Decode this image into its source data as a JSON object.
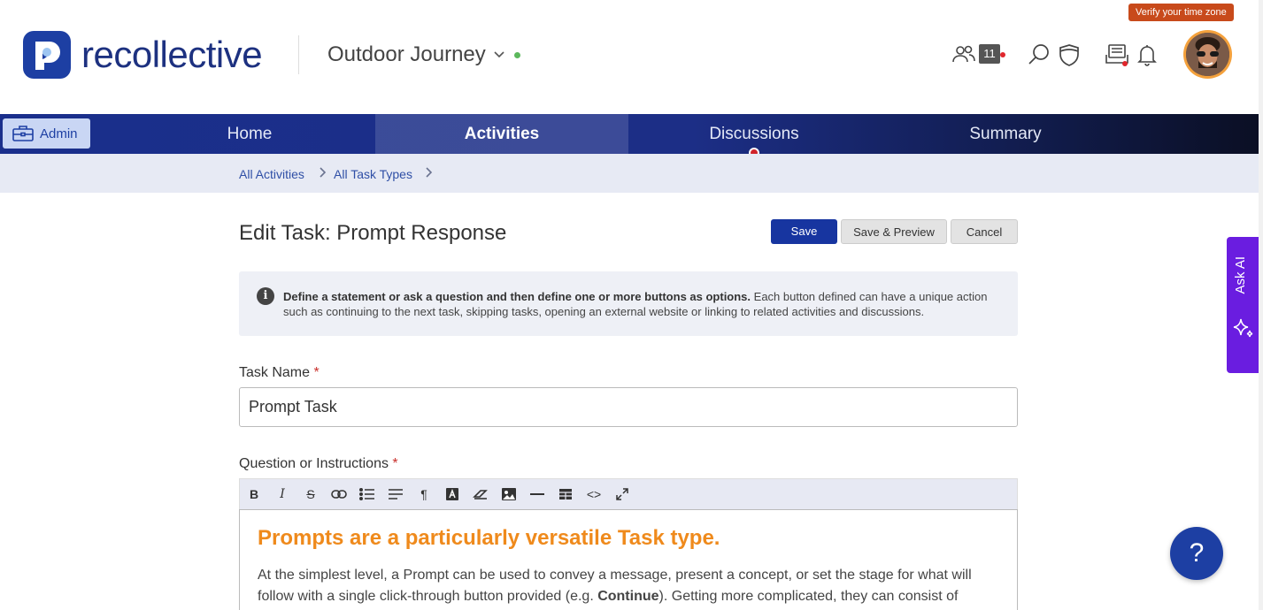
{
  "header": {
    "brand": "recollective",
    "project": "Outdoor Journey",
    "member_count": "11",
    "timezone_badge": "Verify your time zone",
    "icons": [
      "members-icon",
      "search-icon",
      "shield-icon",
      "inbox-icon",
      "bell-icon"
    ]
  },
  "nav": {
    "admin": "Admin",
    "items": [
      "Home",
      "Activities",
      "Discussions",
      "Summary"
    ],
    "active": "Activities"
  },
  "breadcrumb": [
    "All Activities",
    "All Task Types"
  ],
  "page": {
    "title": "Edit Task: Prompt Response",
    "save": "Save",
    "save_preview": "Save & Preview",
    "cancel": "Cancel"
  },
  "info": {
    "bold": "Define a statement or ask a question and then define one or more buttons as options.",
    "rest": " Each button defined can have a unique action such as continuing to the next task, skipping tasks, opening an external website or linking to related activities and discussions."
  },
  "form": {
    "task_name_label": "Task Name",
    "task_name_value": "Prompt Task",
    "question_label": "Question or Instructions",
    "required_mark": "*"
  },
  "toolbar": {
    "bold": "B",
    "italic": "I",
    "strike": "S",
    "paragraph": "¶",
    "code": "<>"
  },
  "editor": {
    "heading": "Prompts are a particularly versatile Task type.",
    "para_1": "At the simplest level, a Prompt can be used to convey a message, present a concept, or set the stage for what will follow with a single click-through button provided (e.g. ",
    "para_bold": "Continue",
    "para_2": "). Getting more complicated, they can consist of multiple buttons that can be used to Segment participants or branch their journey to one place or another part of"
  },
  "widgets": {
    "ask_ai": "Ask AI",
    "help": "?"
  },
  "colors": {
    "brand_blue": "#1d3fa3",
    "accent_orange": "#ef8a1c",
    "ask_ai_purple": "#6a1de0",
    "alert_red": "#d0232a"
  }
}
